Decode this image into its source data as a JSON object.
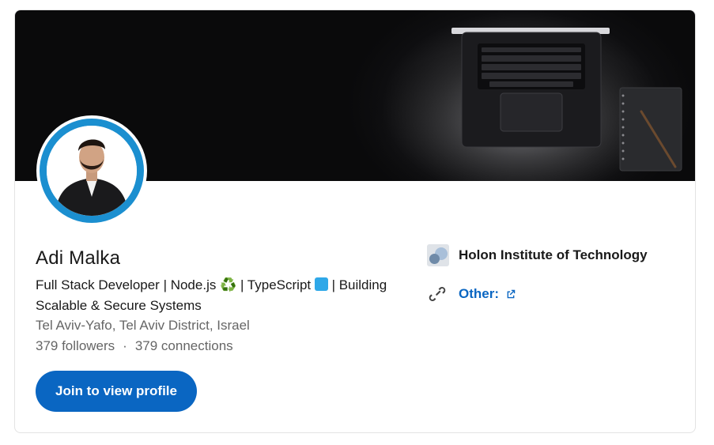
{
  "profile": {
    "name": "Adi Malka",
    "headline_part1": "Full Stack Developer | Node.js ",
    "headline_emoji1": "♻️",
    "headline_part2": " | TypeScript ",
    "headline_part3": " | Building Scalable & Secure Systems",
    "location": "Tel Aviv-Yafo, Tel Aviv District, Israel",
    "followers": "379 followers",
    "separator": "·",
    "connections": "379 connections"
  },
  "actions": {
    "join_label": "Join to view profile"
  },
  "side": {
    "school": "Holon Institute of Technology",
    "other_label": "Other:"
  },
  "colors": {
    "accent": "#0a66c2",
    "avatar_ring": "#1b8fd0",
    "typescript_square": "#2fa8e8",
    "recycle": "#2aa84a"
  },
  "icons": {
    "link": "link-icon",
    "external": "external-link-icon",
    "school_logo": "school-logo"
  }
}
